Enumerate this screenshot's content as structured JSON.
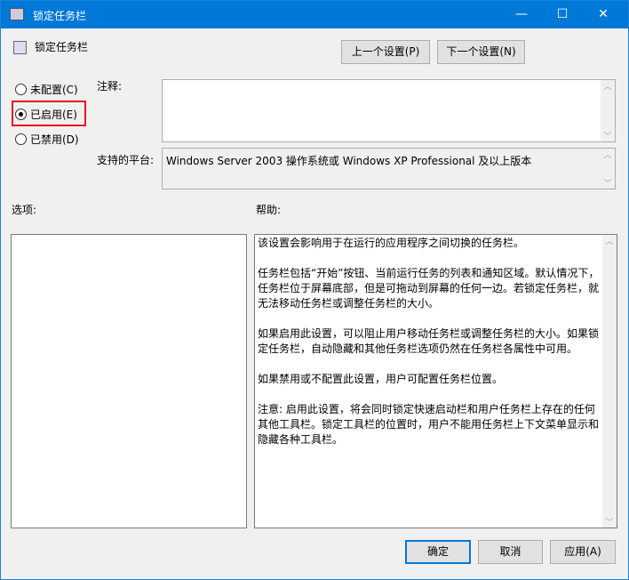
{
  "window": {
    "title": "锁定任务栏",
    "minimize": "—",
    "maximize": "☐",
    "close": "✕"
  },
  "header": {
    "title": "锁定任务栏"
  },
  "nav": {
    "prev": "上一个设置(P)",
    "next": "下一个设置(N)"
  },
  "radios": [
    {
      "label": "未配置(C)",
      "checked": false
    },
    {
      "label": "已启用(E)",
      "checked": true
    },
    {
      "label": "已禁用(D)",
      "checked": false
    }
  ],
  "comment": {
    "label": "注释:",
    "value": ""
  },
  "platform": {
    "label": "支持的平台:",
    "value": "Windows Server 2003 操作系统或 Windows XP Professional 及以上版本"
  },
  "options": {
    "label": "选项:"
  },
  "help": {
    "label": "帮助:",
    "paragraphs": [
      "该设置会影响用于在运行的应用程序之间切换的任务栏。",
      "任务栏包括“开始”按钮、当前运行任务的列表和通知区域。默认情况下，任务栏位于屏幕底部，但是可拖动到屏幕的任何一边。若锁定任务栏，就无法移动任务栏或调整任务栏的大小。",
      "如果启用此设置，可以阻止用户移动任务栏或调整任务栏的大小。如果锁定任务栏，自动隐藏和其他任务栏选项仍然在任务栏各属性中可用。",
      "如果禁用或不配置此设置，用户可配置任务栏位置。",
      "注意: 启用此设置，将会同时锁定快速启动栏和用户任务栏上存在的任何其他工具栏。锁定工具栏的位置时，用户不能用任务栏上下文菜单显示和隐藏各种工具栏。"
    ]
  },
  "buttons": {
    "ok": "确定",
    "cancel": "取消",
    "apply": "应用(A)"
  },
  "colors": {
    "titlebar": "#0078d7",
    "highlight": "#e81123"
  }
}
